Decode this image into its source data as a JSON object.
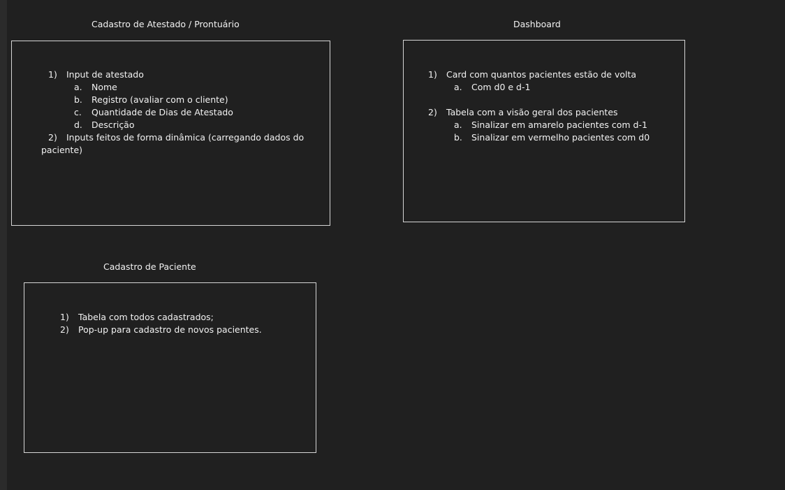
{
  "sections": {
    "atestado": {
      "title": "Cadastro de Atestado / Prontuário",
      "items": {
        "i1": {
          "num": "1)",
          "text": "Input de atestado"
        },
        "a": {
          "num": "a.",
          "text": "Nome"
        },
        "b": {
          "num": "b.",
          "text": "Registro (avaliar com o cliente)"
        },
        "c": {
          "num": "c.",
          "text": "Quantidade de Dias de Atestado"
        },
        "d": {
          "num": "d.",
          "text": "Descrição"
        },
        "i2": {
          "num": "2)",
          "text": "Inputs feitos de forma dinâmica (carregando dados do"
        },
        "i2_cont": "paciente)"
      }
    },
    "dashboard": {
      "title": "Dashboard",
      "items": {
        "i1": {
          "num": "1)",
          "text": "Card com quantos pacientes estão de volta"
        },
        "i1a": {
          "num": "a.",
          "text": "Com d0 e d-1"
        },
        "i2": {
          "num": "2)",
          "text": "Tabela com a visão geral dos pacientes"
        },
        "i2a": {
          "num": "a.",
          "text": "Sinalizar em amarelo pacientes com d-1"
        },
        "i2b": {
          "num": "b.",
          "text": "Sinalizar em vermelho pacientes com d0"
        }
      }
    },
    "paciente": {
      "title": "Cadastro de Paciente",
      "items": {
        "i1": {
          "num": "1)",
          "text": "Tabela com todos cadastrados;"
        },
        "i2": {
          "num": "2)",
          "text": "Pop-up para cadastro de novos pacientes."
        }
      }
    }
  }
}
